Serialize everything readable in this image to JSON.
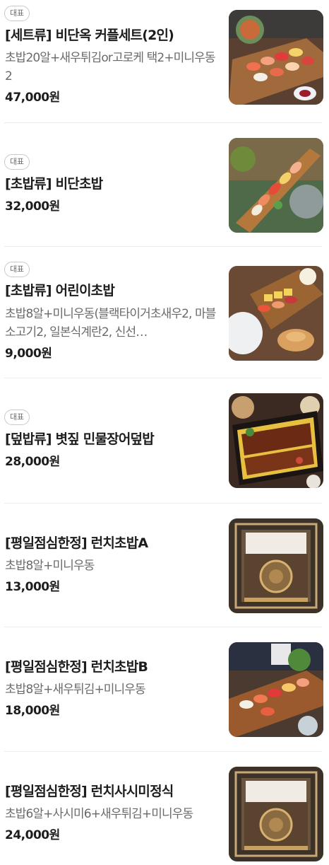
{
  "menu": {
    "badge_label": "대표",
    "items": [
      {
        "badge": "대표",
        "name": "[세트류] 비단옥 커플세트(2인)",
        "description": "초밥20알+새우튀김or고로케 택2+미니우동2",
        "price": "47,000원",
        "image": "sushi-platter-photo"
      },
      {
        "badge": "대표",
        "name": "[초밥류] 비단초밥",
        "description": "",
        "price": "32,000원",
        "image": "sushi-boat-photo"
      },
      {
        "badge": "대표",
        "name": "[초밥류] 어린이초밥",
        "description": "초밥8알+미니우동(블랙타이거초새우2, 마블소고기2, 일본식계란2, 신선…",
        "price": "9,000원",
        "image": "kids-sushi-photo"
      },
      {
        "badge": "대표",
        "name": "[덮밥류] 볏짚 민물장어덮밥",
        "description": "",
        "price": "28,000원",
        "image": "eel-rice-bowl-photo"
      },
      {
        "badge": "",
        "name": "[평일점심한정] 런치초밥A",
        "description": "초밥8알+미니우동",
        "price": "13,000원",
        "image": "restaurant-entrance-photo"
      },
      {
        "badge": "",
        "name": "[평일점심한정] 런치초밥B",
        "description": "초밥8알+새우튀김+미니우동",
        "price": "18,000원",
        "image": "sushi-platter-photo"
      },
      {
        "badge": "",
        "name": "[평일점심한정] 런치사시미정식",
        "description": "초밥6알+사시미6+새우튀김+미니우동",
        "price": "24,000원",
        "image": "restaurant-entrance-photo"
      }
    ]
  }
}
